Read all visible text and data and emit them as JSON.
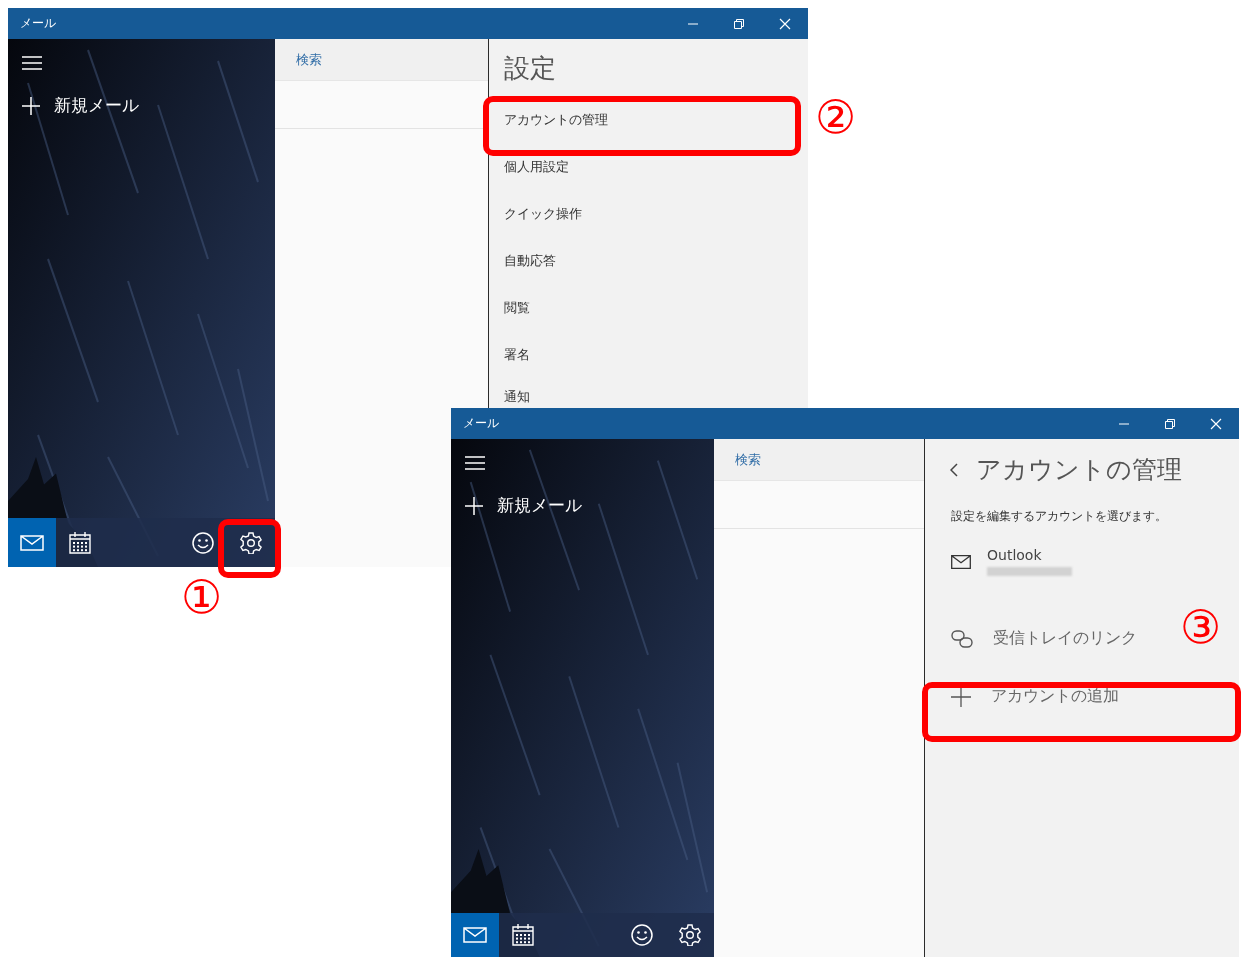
{
  "windows": [
    {
      "title": "メール",
      "nav": {
        "new_mail": "新規メール",
        "bottom_buttons": [
          {
            "kind": "mail",
            "selected": true
          },
          {
            "kind": "calendar",
            "selected": false
          },
          {
            "kind": "smiley",
            "selected": false
          },
          {
            "kind": "gear",
            "selected": false
          }
        ]
      },
      "search": "検索",
      "panel": {
        "kind": "settings",
        "title": "設定",
        "items": [
          "アカウントの管理",
          "個人用設定",
          "クイック操作",
          "自動応答",
          "閲覧",
          "署名",
          "通知"
        ]
      }
    },
    {
      "title": "メール",
      "nav": {
        "new_mail": "新規メール",
        "bottom_buttons": [
          {
            "kind": "mail",
            "selected": true
          },
          {
            "kind": "calendar",
            "selected": false
          },
          {
            "kind": "smiley",
            "selected": false
          },
          {
            "kind": "gear",
            "selected": false
          }
        ]
      },
      "search": "検索",
      "panel": {
        "kind": "accounts",
        "title": "アカウントの管理",
        "subtitle": "設定を編集するアカウントを選びます。",
        "accounts": [
          {
            "name": "Outlook"
          }
        ],
        "actions": [
          {
            "kind": "link",
            "label": "受信トレイのリンク"
          },
          {
            "kind": "add",
            "label": "アカウントの追加"
          }
        ]
      }
    }
  ],
  "callouts": [
    {
      "number": "①"
    },
    {
      "number": "②"
    },
    {
      "number": "③"
    }
  ]
}
